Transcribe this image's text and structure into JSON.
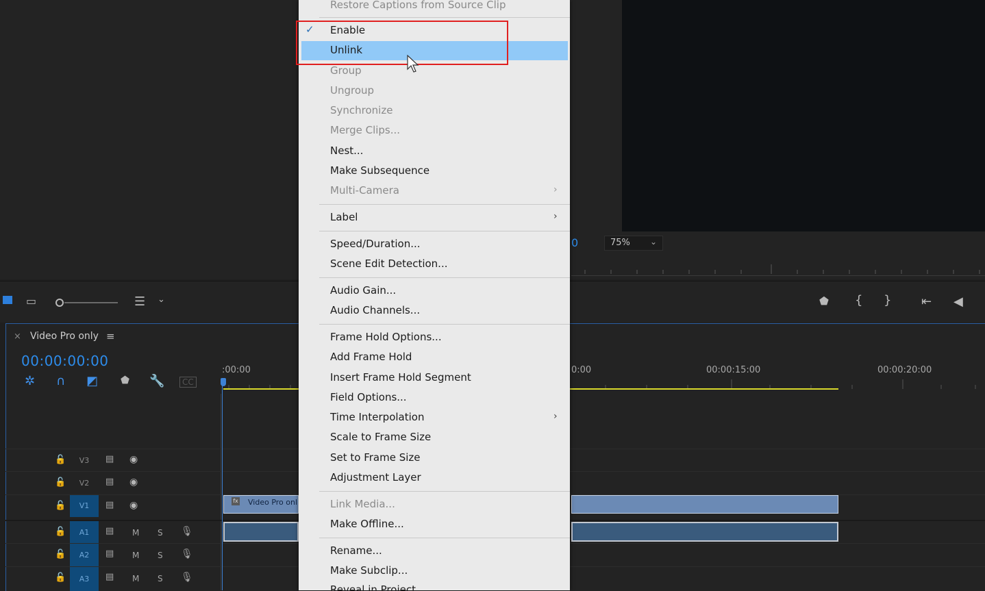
{
  "program_monitor": {
    "timecode_tail": "0",
    "zoom_level": "75%"
  },
  "timeline": {
    "sequence_name": "Video Pro only",
    "timecode": "00:00:00:00",
    "ruler_labels": [
      ":00:00",
      "0:00",
      "00:00:15:00",
      "00:00:20:00"
    ],
    "tracks": {
      "video": [
        "V3",
        "V2",
        "V1"
      ],
      "audio": [
        "A1",
        "A2",
        "A3"
      ],
      "mute_label": "M",
      "solo_label": "S"
    },
    "clip_label": "Video Pro onl"
  },
  "context_menu": {
    "items": [
      {
        "label": "Restore Captions from Source Clip",
        "enabled": false
      },
      {
        "label": "Enable",
        "enabled": true,
        "checked": true
      },
      {
        "label": "Unlink",
        "enabled": true,
        "highlighted": true
      },
      {
        "label": "Group",
        "enabled": false
      },
      {
        "label": "Ungroup",
        "enabled": false
      },
      {
        "label": "Synchronize",
        "enabled": false
      },
      {
        "label": "Merge Clips...",
        "enabled": false
      },
      {
        "label": "Nest...",
        "enabled": true
      },
      {
        "label": "Make Subsequence",
        "enabled": true
      },
      {
        "label": "Multi-Camera",
        "enabled": false,
        "submenu": true
      },
      {
        "label": "Label",
        "enabled": true,
        "submenu": true
      },
      {
        "label": "Speed/Duration...",
        "enabled": true
      },
      {
        "label": "Scene Edit Detection...",
        "enabled": true
      },
      {
        "label": "Audio Gain...",
        "enabled": true
      },
      {
        "label": "Audio Channels...",
        "enabled": true
      },
      {
        "label": "Frame Hold Options...",
        "enabled": true
      },
      {
        "label": "Add Frame Hold",
        "enabled": true
      },
      {
        "label": "Insert Frame Hold Segment",
        "enabled": true
      },
      {
        "label": "Field Options...",
        "enabled": true
      },
      {
        "label": "Time Interpolation",
        "enabled": true,
        "submenu": true
      },
      {
        "label": "Scale to Frame Size",
        "enabled": true
      },
      {
        "label": "Set to Frame Size",
        "enabled": true
      },
      {
        "label": "Adjustment Layer",
        "enabled": true
      },
      {
        "label": "Link Media...",
        "enabled": false
      },
      {
        "label": "Make Offline...",
        "enabled": true
      },
      {
        "label": "Rename...",
        "enabled": true
      },
      {
        "label": "Make Subclip...",
        "enabled": true
      },
      {
        "label": "Reveal in Project",
        "enabled": true
      }
    ],
    "highlight_color": "#91c9f7",
    "annotation_color": "#e02020"
  },
  "icons": {
    "close": "×",
    "hamburger": "≡",
    "check": "✓",
    "submenu": "›",
    "lock": "🔓",
    "eye": "👁",
    "mic": "🎙"
  }
}
